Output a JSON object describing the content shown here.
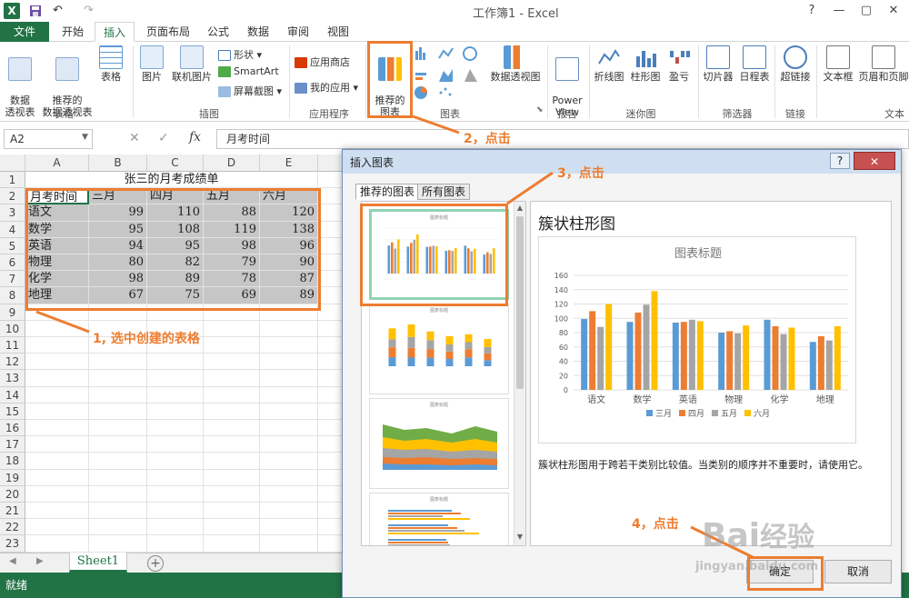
{
  "titlebar": {
    "title": "工作簿1 - Excel",
    "app_icon": "X",
    "qa_save": "save-icon",
    "qa_undo": "↶",
    "qa_redo": "↷",
    "help": "?",
    "win_minimize": "—",
    "win_restore": "▢",
    "win_close": "✕"
  },
  "tabs": [
    "文件",
    "开始",
    "插入",
    "页面布局",
    "公式",
    "数据",
    "审阅",
    "视图"
  ],
  "ribbon": {
    "pivot_table": "数据\n透视表",
    "recommended_pivot": "推荐的\n数据透视表",
    "table": "表格",
    "group_tables": "表格",
    "picture": "图片",
    "online_picture": "联机图片",
    "shapes": "形状",
    "smartart": "SmartArt",
    "screenshot": "屏幕截图",
    "group_illustrations": "插图",
    "app_store": "应用商店",
    "my_apps": "我的应用",
    "group_apps": "应用程序",
    "recommended_charts": "推荐的\n图表",
    "pivot_chart": "数据透视图",
    "group_charts": "图表",
    "power_view": "Power\nView",
    "group_reports": "报告",
    "line": "折线图",
    "column": "柱形图",
    "winloss": "盈亏",
    "group_sparklines": "迷你图",
    "slicer": "切片器",
    "timeline": "日程表",
    "group_filters": "筛选器",
    "hyperlink": "超链接",
    "group_links": "链接",
    "textbox": "文本框",
    "header_footer": "页眉和页脚",
    "group_text": "文本"
  },
  "formula": {
    "namebox": "A2",
    "cancel": "✕",
    "enter": "✓",
    "fx": "fx",
    "content": "月考时间"
  },
  "sheet": {
    "columns": [
      "A",
      "B",
      "C",
      "D",
      "E"
    ],
    "rows": [
      "1",
      "2",
      "3",
      "4",
      "5",
      "6",
      "7",
      "8",
      "9",
      "10",
      "11",
      "12",
      "13",
      "14",
      "15",
      "16",
      "17",
      "18",
      "19",
      "20",
      "21",
      "22",
      "23"
    ],
    "title": "张三的月考成绩单",
    "header": [
      "月考时间",
      "三月",
      "四月",
      "五月",
      "六月"
    ],
    "data": [
      [
        "语文",
        "99",
        "110",
        "88",
        "120"
      ],
      [
        "数学",
        "95",
        "108",
        "119",
        "138"
      ],
      [
        "英语",
        "94",
        "95",
        "98",
        "96"
      ],
      [
        "物理",
        "80",
        "82",
        "79",
        "90"
      ],
      [
        "化学",
        "98",
        "89",
        "78",
        "87"
      ],
      [
        "地理",
        "67",
        "75",
        "69",
        "89"
      ]
    ],
    "tab_name": "Sheet1",
    "add_sheet": "+",
    "nav_prev": "◀",
    "nav_next": "▶"
  },
  "status": {
    "ready": "就绪"
  },
  "dialog": {
    "title": "插入图表",
    "help": "?",
    "close": "✕",
    "tab_recommended": "推荐的图表",
    "tab_all": "所有图表",
    "thumb_title": "图表标题",
    "chart_name": "簇状柱形图",
    "description": "簇状柱形图用于跨若干类别比较值。当类别的顺序并不重要时，请使用它。",
    "ok": "确定",
    "cancel": "取消"
  },
  "chart_data": {
    "type": "bar",
    "title": "图表标题",
    "categories": [
      "语文",
      "数学",
      "英语",
      "物理",
      "化学",
      "地理"
    ],
    "series": [
      {
        "name": "三月",
        "values": [
          99,
          95,
          94,
          80,
          98,
          67
        ]
      },
      {
        "name": "四月",
        "values": [
          110,
          108,
          95,
          82,
          89,
          75
        ]
      },
      {
        "name": "五月",
        "values": [
          88,
          119,
          98,
          79,
          78,
          69
        ]
      },
      {
        "name": "六月",
        "values": [
          120,
          138,
          96,
          90,
          87,
          89
        ]
      }
    ],
    "colors": [
      "#5b9bd5",
      "#ed7d31",
      "#a5a5a5",
      "#ffc000"
    ],
    "ylim": [
      0,
      160
    ],
    "yticks": [
      0,
      20,
      40,
      60,
      80,
      100,
      120,
      140,
      160
    ],
    "grid": true,
    "legend": "bottom"
  },
  "annotations": {
    "step1": "1, 选中创建的表格",
    "step2": "2，点击",
    "step3": "3，点击",
    "step4": "4，点击"
  },
  "watermark": {
    "brand": "Bai",
    "brand2": "经验",
    "url": "jingyan.baidu.com"
  },
  "colors": {
    "excel_green": "#217346",
    "annotation_orange": "#ed7d31"
  }
}
